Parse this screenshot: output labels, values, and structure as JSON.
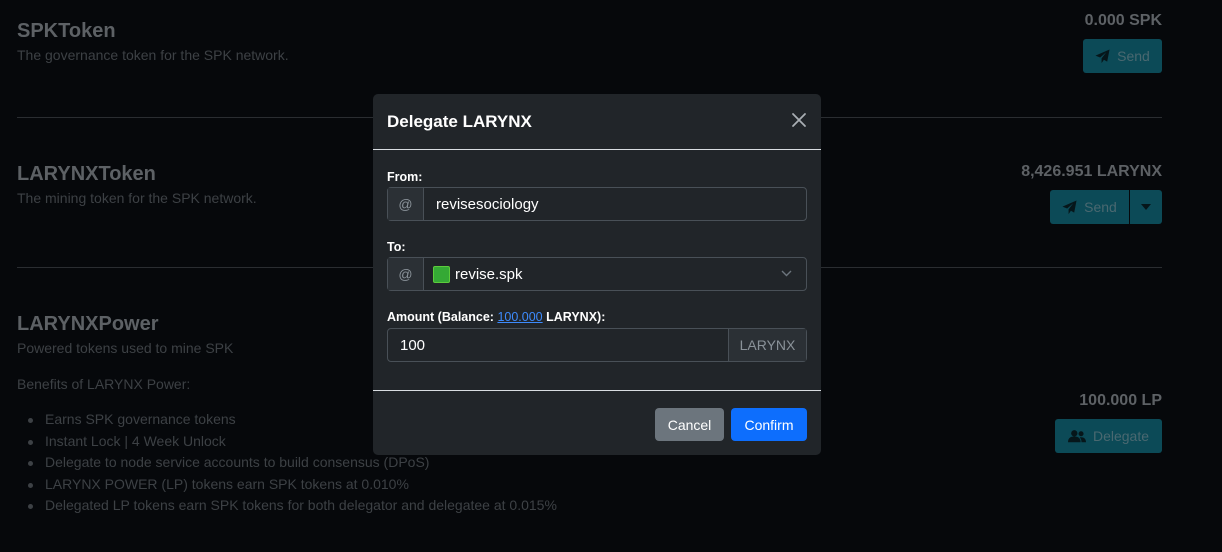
{
  "tokens": [
    {
      "name": "SPKToken",
      "description": "The governance token for the SPK network.",
      "balance": "0.000 SPK",
      "action": "Send"
    },
    {
      "name": "LARYNXToken",
      "description": "The mining token for the SPK network.",
      "balance": "8,426.951 LARYNX",
      "action": "Send"
    },
    {
      "name": "LARYNXPower",
      "description": "Powered tokens used to mine SPK",
      "balance": "100.000 LP",
      "action": "Delegate"
    }
  ],
  "benefits": {
    "title": "Benefits of LARYNX Power:",
    "items": [
      "Earns SPK governance tokens",
      "Instant Lock | 4 Week Unlock",
      "Delegate to node service accounts to build consensus (DPoS)",
      "LARYNX POWER (LP) tokens earn SPK tokens at 0.010%",
      "Delegated LP tokens earn SPK tokens for both delegator and delegatee at 0.015%"
    ]
  },
  "modal": {
    "title": "Delegate LARYNX",
    "from_label": "From:",
    "from_prefix": "@",
    "from_value": "revisesociology",
    "to_label": "To:",
    "to_prefix": "@",
    "to_value": "revise.spk",
    "amount_label_pre": "Amount (Balance: ",
    "amount_balance_link": "100.000",
    "amount_label_post": " LARYNX):",
    "amount_value": "100",
    "amount_unit": "LARYNX",
    "cancel_label": "Cancel",
    "confirm_label": "Confirm"
  },
  "colors": {
    "accent_teal": "#0c4a57",
    "confirm_blue": "#0d6efd",
    "cancel_gray": "#6c757d",
    "modal_bg": "#212529"
  }
}
